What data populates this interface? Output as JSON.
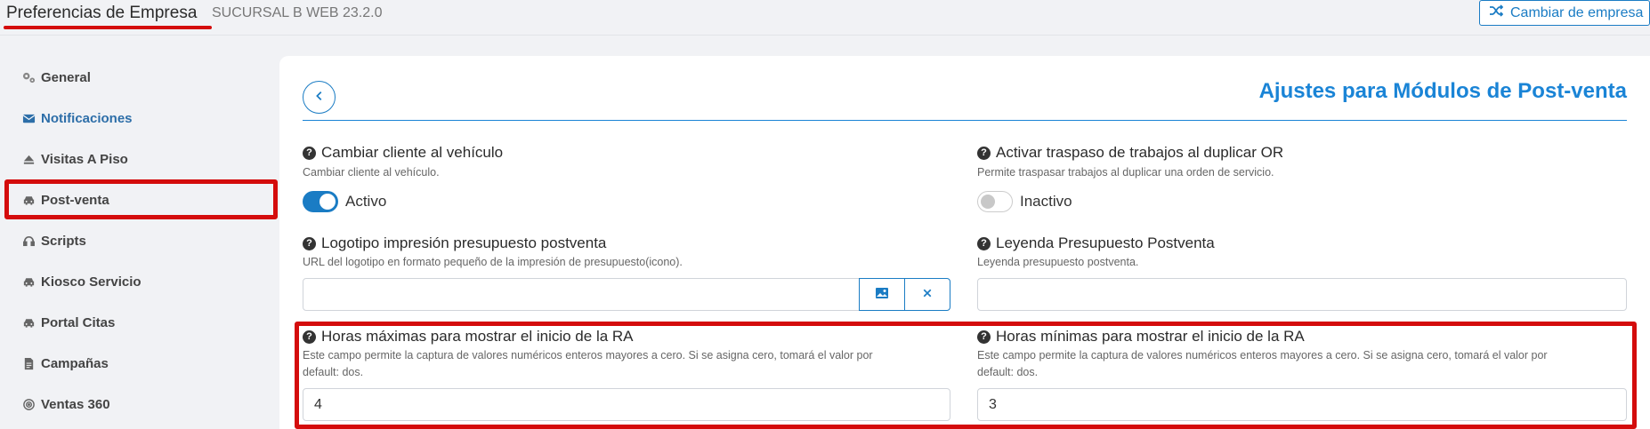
{
  "header": {
    "title": "Preferencias de Empresa",
    "subtitle": "SUCURSAL B WEB 23.2.0",
    "switch_company_label": "Cambiar de empresa",
    "switch_company_icon": "shuffle-icon"
  },
  "sidebar": {
    "items": [
      {
        "label": "General",
        "icon": "gears-icon"
      },
      {
        "label": "Notificaciones",
        "icon": "envelope-icon"
      },
      {
        "label": "Visitas A Piso",
        "icon": "eject-icon"
      },
      {
        "label": "Post-venta",
        "icon": "car-icon",
        "active": true
      },
      {
        "label": "Scripts",
        "icon": "headset-icon"
      },
      {
        "label": "Kiosco Servicio",
        "icon": "car-icon"
      },
      {
        "label": "Portal Citas",
        "icon": "car-icon"
      },
      {
        "label": "Campañas",
        "icon": "document-icon"
      },
      {
        "label": "Ventas 360",
        "icon": "target-icon"
      }
    ]
  },
  "main": {
    "section_title": "Ajustes para Módulos de Post-venta",
    "fields": {
      "cambiar_cliente": {
        "label": "Cambiar cliente al vehículo",
        "desc": "Cambiar cliente al vehículo.",
        "state": "Activo",
        "on": true
      },
      "activar_traspaso": {
        "label": "Activar traspaso de trabajos al duplicar OR",
        "desc": "Permite traspasar trabajos al duplicar una orden de servicio.",
        "state": "Inactivo",
        "on": false
      },
      "logotipo": {
        "label": "Logotipo impresión presupuesto postventa",
        "desc": "URL del logotipo en formato pequeño de la impresión de presupuesto(icono).",
        "value": ""
      },
      "leyenda": {
        "label": "Leyenda Presupuesto Postventa",
        "desc": "Leyenda presupuesto postventa.",
        "value": ""
      },
      "horas_max": {
        "label": "Horas máximas para mostrar el inicio de la RA",
        "desc_line1": "Este campo permite la captura de valores numéricos enteros mayores a cero. Si se asigna cero, tomará el valor por",
        "desc_line2": "default: dos.",
        "value": "4"
      },
      "horas_min": {
        "label": "Horas mínimas para mostrar el inicio de la RA",
        "desc_line1": "Este campo permite la captura de valores numéricos enteros mayores a cero. Si se asigna cero, tomará el valor por",
        "desc_line2": "default: dos.",
        "value": "3"
      }
    }
  },
  "colors": {
    "accent": "#1a7cc4",
    "highlight": "#d40c0c"
  }
}
